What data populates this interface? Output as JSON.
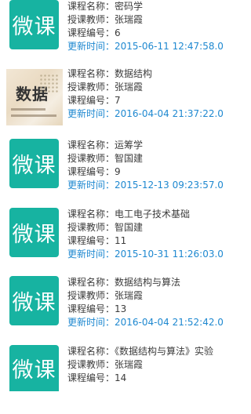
{
  "labels": {
    "name": "课程名称：",
    "teacher": "授课教师：",
    "code": "课程编号：",
    "updated": "更新时间："
  },
  "courses": [
    {
      "thumb": "微课",
      "name": "密码学",
      "teacher": "张瑞霞",
      "code": "6",
      "updated": "2015-06-11 12:47:58.0"
    },
    {
      "thumb": "数据",
      "name": "数据结构",
      "teacher": "张瑞霞",
      "code": "7",
      "updated": "2016-04-04 21:37:22.0"
    },
    {
      "thumb": "微课",
      "name": "运筹学",
      "teacher": "智国建",
      "code": "9",
      "updated": "2015-12-13 09:23:57.0"
    },
    {
      "thumb": "微课",
      "name": "电工电子技术基础",
      "teacher": "智国建",
      "code": "11",
      "updated": "2015-10-31 11:26:03.0"
    },
    {
      "thumb": "微课",
      "name": "数据结构与算法",
      "teacher": "张瑞霞",
      "code": "13",
      "updated": "2016-04-04 21:52:42.0"
    },
    {
      "thumb": "微课",
      "name": "《数据结构与算法》实验",
      "teacher": "张瑞霞",
      "code": "14",
      "updated": ""
    }
  ]
}
